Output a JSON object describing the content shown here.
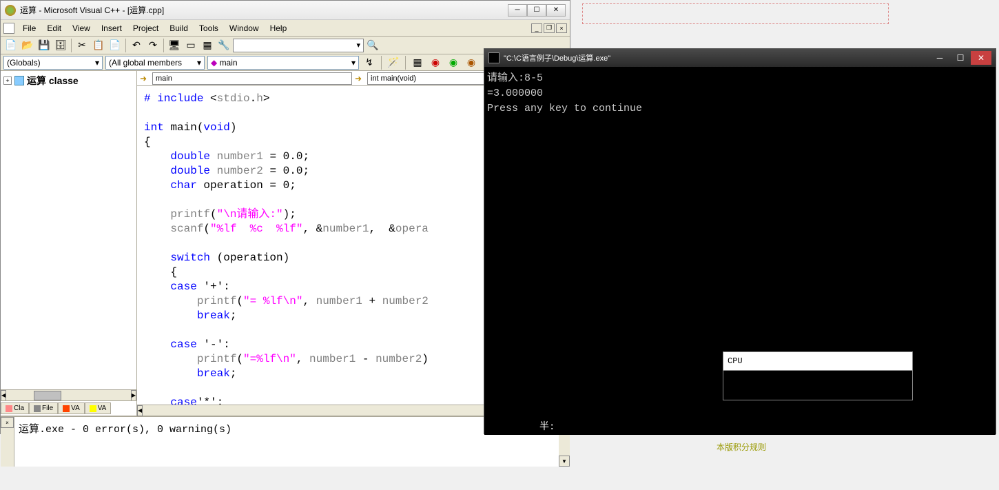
{
  "vc": {
    "title": "运算 - Microsoft Visual C++ - [运算.cpp]",
    "menus": [
      "File",
      "Edit",
      "View",
      "Insert",
      "Project",
      "Build",
      "Tools",
      "Window",
      "Help"
    ],
    "context": {
      "globals": "(Globals)",
      "members": "(All global members",
      "func": "main"
    },
    "nav": {
      "left": "main",
      "right": "int main(void)"
    },
    "tree_root": "运算 classe",
    "tabs": [
      "Cla",
      "File",
      "VA",
      "VA"
    ],
    "code": {
      "l1_a": "# ",
      "l1_b": "include",
      "l1_c": " <",
      "l1_d": "stdio",
      "l1_e": ".",
      "l1_f": "h",
      "l1_g": ">",
      "l3_a": "int",
      "l3_b": " main(",
      "l3_c": "void",
      "l3_d": ")",
      "l4": "{",
      "l5_a": "    ",
      "l5_b": "double",
      "l5_c": " ",
      "l5_d": "number1",
      "l5_e": " = 0.0;",
      "l6_a": "    ",
      "l6_b": "double",
      "l6_c": " ",
      "l6_d": "number2",
      "l6_e": " = 0.0;",
      "l7_a": "    ",
      "l7_b": "char",
      "l7_c": " operation = 0;",
      "l9_a": "    ",
      "l9_b": "printf",
      "l9_c": "(",
      "l9_d": "\"\\n请输入:\"",
      "l9_e": ");",
      "l10_a": "    ",
      "l10_b": "scanf",
      "l10_c": "(",
      "l10_d": "\"%lf  %c  %lf\"",
      "l10_e": ", &",
      "l10_f": "number1",
      "l10_g": ",  &",
      "l10_h": "opera",
      "l12_a": "    ",
      "l12_b": "switch",
      "l12_c": " (operation)",
      "l13": "    {",
      "l14_a": "    ",
      "l14_b": "case",
      "l14_c": " '+':",
      "l15_a": "        ",
      "l15_b": "printf",
      "l15_c": "(",
      "l15_d": "\"= %lf\\n\"",
      "l15_e": ", ",
      "l15_f": "number1",
      "l15_g": " + ",
      "l15_h": "number2",
      "l16_a": "        ",
      "l16_b": "break",
      "l16_c": ";",
      "l18_a": "    ",
      "l18_b": "case",
      "l18_c": " '-':",
      "l19_a": "        ",
      "l19_b": "printf",
      "l19_c": "(",
      "l19_d": "\"=%lf\\n\"",
      "l19_e": ", ",
      "l19_f": "number1",
      "l19_g": " - ",
      "l19_h": "number2",
      "l19_i": ")",
      "l20_a": "        ",
      "l20_b": "break",
      "l20_c": ";",
      "l22_a": "    ",
      "l22_b": "case",
      "l22_c": "'*':"
    },
    "output": "运算.exe - 0 error(s), 0 warning(s)"
  },
  "console": {
    "title": "\"C:\\C语言例子\\Debug\\运算.exe\"",
    "line1": "请输入:8-5",
    "line2": "=3.000000",
    "line3": "Press any key to continue",
    "ime": "半:",
    "tooltip": "CPU"
  },
  "footer": {
    "link": "本版积分规则"
  }
}
